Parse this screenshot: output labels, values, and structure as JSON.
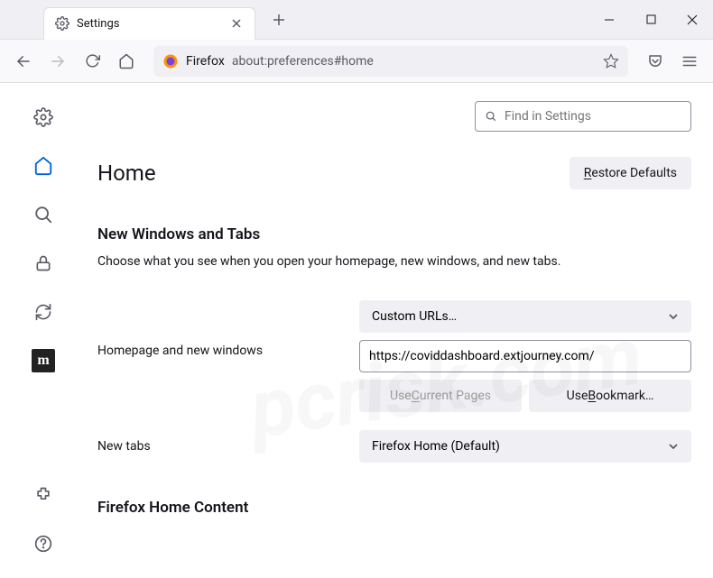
{
  "tab": {
    "title": "Settings"
  },
  "urlbar": {
    "identity": "Firefox",
    "url": "about:preferences#home"
  },
  "search": {
    "placeholder": "Find in Settings"
  },
  "page": {
    "title": "Home",
    "restore_btn": "Restore Defaults",
    "restore_accesskey": "R"
  },
  "section1": {
    "title": "New Windows and Tabs",
    "desc": "Choose what you see when you open your homepage, new windows, and new tabs."
  },
  "homepage": {
    "label": "Homepage and new windows",
    "select_value": "Custom URLs…",
    "url_value": "https://coviddashboard.extjourney.com/",
    "use_current": "Use Current Pages",
    "use_current_accesskey": "C",
    "use_bookmark": "Use Bookmark…",
    "use_bookmark_accesskey": "B"
  },
  "newtabs": {
    "label": "New tabs",
    "select_value": "Firefox Home (Default)"
  },
  "section2": {
    "title": "Firefox Home Content"
  }
}
